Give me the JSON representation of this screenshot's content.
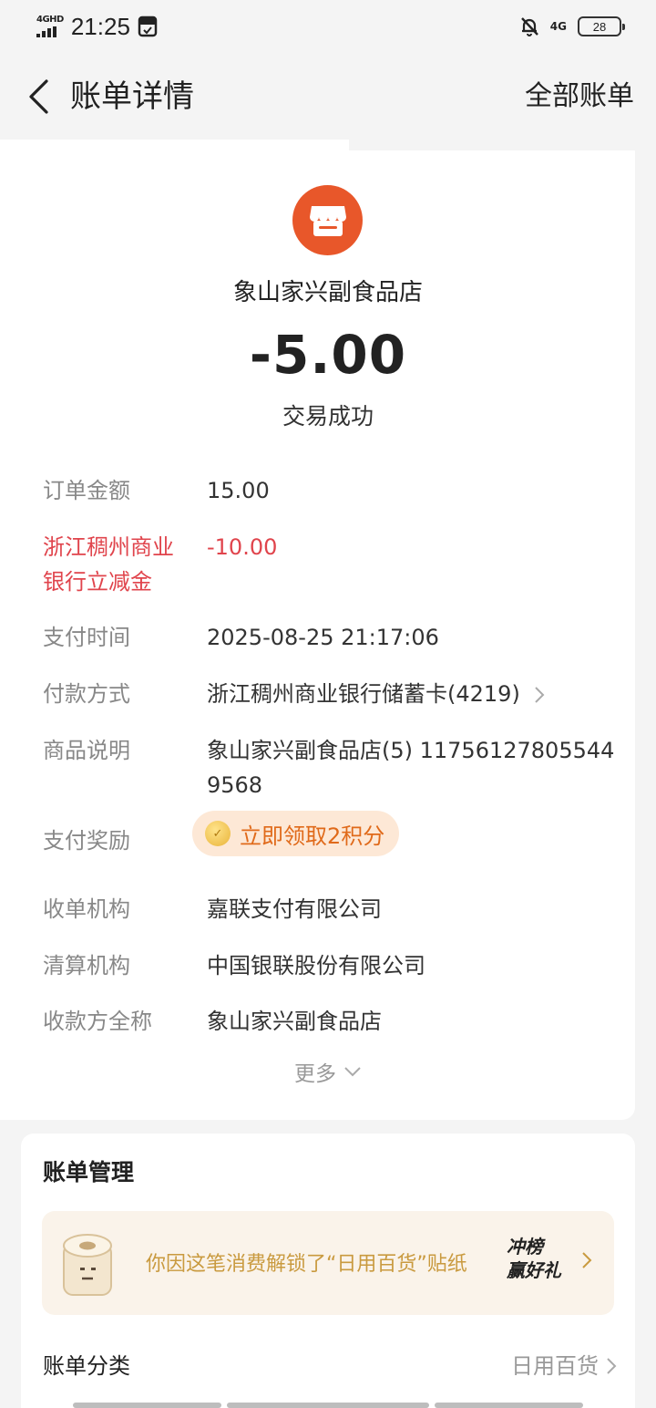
{
  "status_bar": {
    "network": "4GHD",
    "time": "21:25",
    "network_right": "4G",
    "battery": "28"
  },
  "nav": {
    "title": "账单详情",
    "right_link": "全部账单"
  },
  "merchant": {
    "name": "象山家兴副食品店",
    "amount": "-5.00",
    "status": "交易成功",
    "icon_color": "#e8572a"
  },
  "details": {
    "order_amount": {
      "label": "订单金额",
      "value": "15.00"
    },
    "discount": {
      "label_line1": "浙江稠州商业",
      "label_line2": "银行立减金",
      "value": "-10.00"
    },
    "pay_time": {
      "label": "支付时间",
      "value": "2025-08-25 21:17:06"
    },
    "pay_method": {
      "label": "付款方式",
      "value": "浙江稠州商业银行储蓄卡(4219)"
    },
    "goods_desc": {
      "label": "商品说明",
      "value_line1": "象山家兴副食品店(5) 11756127805544",
      "value_line2": "9568"
    },
    "reward": {
      "label": "支付奖励",
      "value": "立即领取2积分"
    },
    "acquirer": {
      "label": "收单机构",
      "value": "嘉联支付有限公司"
    },
    "clearing": {
      "label": "清算机构",
      "value": "中国银联股份有限公司"
    },
    "payee": {
      "label": "收款方全称",
      "value": "象山家兴副食品店"
    },
    "more": "更多"
  },
  "manage": {
    "title": "账单管理",
    "banner_text": "你因这笔消费解锁了“日用百货”贴纸",
    "badge_line1": "冲榜",
    "badge_line2": "赢好礼",
    "category_label": "账单分类",
    "category_value": "日用百货"
  },
  "colors": {
    "accent_red": "#e0444c",
    "reward_orange": "#e06a1a",
    "banner_gold": "#c99a3f"
  }
}
